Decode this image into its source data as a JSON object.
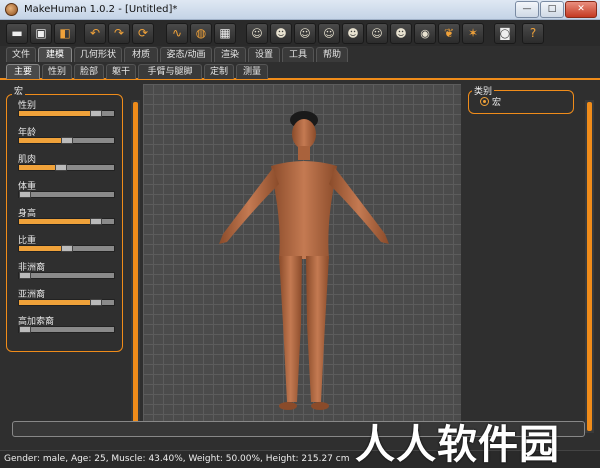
{
  "window": {
    "title": "MakeHuman 1.0.2 - [Untitled]*",
    "controls": {
      "minimize": "—",
      "maximize": "□",
      "close": "✕"
    }
  },
  "toolbar": {
    "buttons": [
      {
        "name": "undo-icon",
        "glyph": "↶"
      },
      {
        "name": "redo-icon",
        "glyph": "↷"
      },
      {
        "name": "reset-icon",
        "glyph": "⟳"
      }
    ]
  },
  "menu_tabs": [
    "文件",
    "建模",
    "几何形状",
    "材质",
    "姿态/动画",
    "渲染",
    "设置",
    "工具",
    "帮助"
  ],
  "sub_tabs": [
    "主要",
    "性别",
    "脸部",
    "躯干",
    "手臂与腿脚",
    "定制",
    "测量"
  ],
  "left_panel": {
    "title": "宏",
    "sliders": [
      {
        "label": "性别",
        "value": 0.85
      },
      {
        "label": "年龄",
        "value": 0.5
      },
      {
        "label": "肌肉",
        "value": 0.43
      },
      {
        "label": "体重",
        "value": 0.0
      },
      {
        "label": "身高",
        "value": 0.85
      },
      {
        "label": "比重",
        "value": 0.5
      },
      {
        "label": "非洲裔",
        "value": 0.0
      },
      {
        "label": "亚洲裔",
        "value": 0.85
      },
      {
        "label": "高加索裔",
        "value": 0.0
      }
    ]
  },
  "right_panel": {
    "title": "类别",
    "options": [
      {
        "label": "宏",
        "selected": true
      }
    ]
  },
  "status": {
    "text": "Gender: male, Age: 25, Muscle: 43.40%, Weight: 50.00%, Height: 215.27 cm"
  },
  "watermark": {
    "text": "人人软件园"
  },
  "colors": {
    "accent": "#f08c1a",
    "fill": "#f0a23a",
    "background": "#2f2f2f",
    "viewport": "#4b4b4b"
  }
}
